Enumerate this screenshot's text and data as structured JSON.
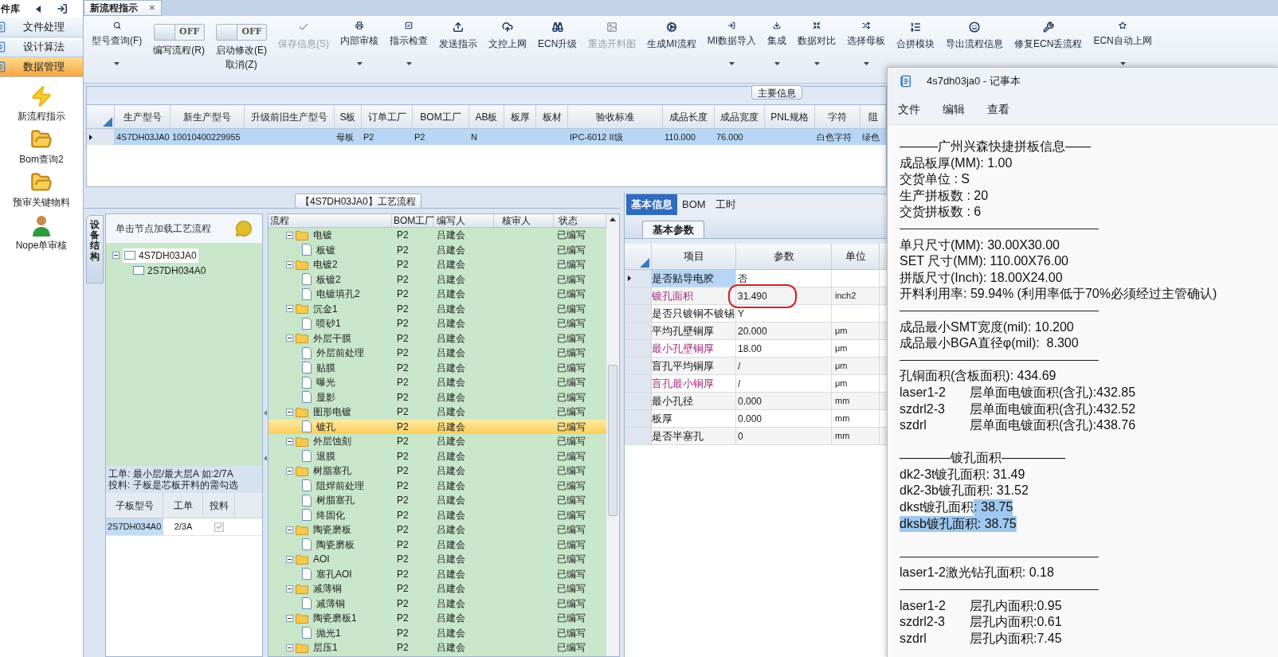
{
  "sidebar": {
    "title": "件库",
    "menu": [
      {
        "label": "文件处理",
        "selected": false
      },
      {
        "label": "设计算法",
        "selected": false
      },
      {
        "label": "数据管理",
        "selected": true
      }
    ],
    "launchers": [
      {
        "label": "新流程指示"
      },
      {
        "label": "Bom查询2"
      },
      {
        "label": "预审关键物料"
      },
      {
        "label": "Nope单审核"
      }
    ]
  },
  "document_tab": {
    "label": "新流程指示",
    "close": "×"
  },
  "toolbar": [
    {
      "kind": "button",
      "label": "型号查询(F)",
      "menu": true,
      "disabled": false
    },
    {
      "kind": "toggle",
      "label": "编写流程(R)",
      "on": false,
      "switch_text": "OFF"
    },
    {
      "kind": "toggle",
      "label": "启动修改(E)",
      "sublabel": "取消(Z)",
      "on": false,
      "switch_text": "OFF"
    },
    {
      "kind": "button",
      "label": "保存信息(S)",
      "menu": false,
      "disabled": true
    },
    {
      "kind": "button",
      "label": "内部审核",
      "menu": true,
      "disabled": false
    },
    {
      "kind": "button",
      "label": "指示检查",
      "menu": true,
      "disabled": false
    },
    {
      "kind": "button",
      "label": "发送指示",
      "menu": false,
      "disabled": false
    },
    {
      "kind": "button",
      "label": "文控上网",
      "menu": false,
      "disabled": false
    },
    {
      "kind": "button",
      "label": "ECN升级",
      "menu": false,
      "disabled": false
    },
    {
      "kind": "button",
      "label": "重选开料图",
      "menu": false,
      "disabled": true
    },
    {
      "kind": "button",
      "label": "生成MI流程",
      "menu": false,
      "disabled": false
    },
    {
      "kind": "button",
      "label": "MI数据导入",
      "menu": true,
      "disabled": false
    },
    {
      "kind": "button",
      "label": "集成",
      "menu": true,
      "disabled": false
    },
    {
      "kind": "button",
      "label": "数据对比",
      "menu": true,
      "disabled": false
    },
    {
      "kind": "button",
      "label": "选择母板",
      "menu": true,
      "disabled": false
    },
    {
      "kind": "button",
      "label": "合拼模块",
      "menu": false,
      "disabled": false
    },
    {
      "kind": "button",
      "label": "导出流程信息",
      "menu": false,
      "disabled": false
    },
    {
      "kind": "button",
      "label": "修复ECN丢流程",
      "menu": false,
      "disabled": false
    },
    {
      "kind": "button",
      "label": "ECN自动上网",
      "menu": true,
      "disabled": false
    }
  ],
  "main_info": {
    "title": "主要信息",
    "columns": [
      "生产型号",
      "新生产型号",
      "升级前旧生产型号",
      "S板",
      "订单工厂",
      "BOM工厂",
      "AB板",
      "板厚",
      "板材",
      "验收标准",
      "成品长度",
      "成品宽度",
      "PNL规格",
      "字符",
      "阻"
    ],
    "rows": [
      {
        "selected": true,
        "cells": [
          "4S7DH03JA0",
          "10010400229955",
          null,
          "母板",
          "P2",
          "P2",
          "N",
          null,
          null,
          "IPC-6012 II级",
          "110.000",
          "76.000",
          null,
          "白色字符",
          "绿色"
        ]
      }
    ]
  },
  "left_panel": {
    "vertical_tab": "设备结构",
    "hint": "单击节点加载工艺流程",
    "tree": [
      {
        "label": "4S7DH03JA0",
        "selected": true,
        "expanded": true,
        "children": [
          {
            "label": "2S7DH034A0",
            "selected": false
          }
        ]
      }
    ],
    "notes": [
      "工单: 最小层/最大层A 如:2/7A",
      "投料: 子板是芯板开料的需勾选"
    ],
    "sub_table": {
      "columns": [
        "子板型号",
        "工单",
        "投料"
      ],
      "rows": [
        {
          "board": "2S7DH034A0",
          "order": "2/3A",
          "feed": true
        }
      ]
    }
  },
  "process": {
    "title": "【4S7DH03JA0】工艺流程",
    "columns": [
      "流程",
      "BOM工厂",
      "编写人",
      "核审人",
      "状态"
    ],
    "rows": [
      {
        "name": "电镀",
        "bom": "P2",
        "writer": "吕建会",
        "status": "已编写",
        "selected": false,
        "expanded": true,
        "children": [
          {
            "name": "板镀",
            "bom": "P2",
            "writer": "吕建会",
            "status": "已编写",
            "selected": false
          }
        ]
      },
      {
        "name": "电镀2",
        "bom": "P2",
        "writer": "吕建会",
        "status": "已编写",
        "selected": false,
        "expanded": true,
        "children": [
          {
            "name": "板镀2",
            "bom": "P2",
            "writer": "吕建会",
            "status": "已编写",
            "selected": false
          },
          {
            "name": "电镀填孔2",
            "bom": "P2",
            "writer": "吕建会",
            "status": "已编写",
            "selected": false
          }
        ]
      },
      {
        "name": "沉金1",
        "bom": "P2",
        "writer": "吕建会",
        "status": "已编写",
        "selected": false,
        "expanded": true,
        "children": [
          {
            "name": "喷砂1",
            "bom": "P2",
            "writer": "吕建会",
            "status": "已编写",
            "selected": false
          }
        ]
      },
      {
        "name": "外层干膜",
        "bom": "P2",
        "writer": "吕建会",
        "status": "已编写",
        "selected": false,
        "expanded": true,
        "children": [
          {
            "name": "外层前处理",
            "bom": "P2",
            "writer": "吕建会",
            "status": "已编写",
            "selected": false
          },
          {
            "name": "贴膜",
            "bom": "P2",
            "writer": "吕建会",
            "status": "已编写",
            "selected": false
          },
          {
            "name": "曝光",
            "bom": "P2",
            "writer": "吕建会",
            "status": "已编写",
            "selected": false
          },
          {
            "name": "显影",
            "bom": "P2",
            "writer": "吕建会",
            "status": "已编写",
            "selected": false
          }
        ]
      },
      {
        "name": "图形电镀",
        "bom": "P2",
        "writer": "吕建会",
        "status": "已编写",
        "selected": false,
        "expanded": true,
        "children": [
          {
            "name": "镀孔",
            "bom": "P2",
            "writer": "吕建会",
            "status": "已编写",
            "selected": true
          }
        ]
      },
      {
        "name": "外层蚀刻",
        "bom": "P2",
        "writer": "吕建会",
        "status": "已编写",
        "selected": false,
        "expanded": true,
        "children": [
          {
            "name": "退膜",
            "bom": "P2",
            "writer": "吕建会",
            "status": "已编写",
            "selected": false
          }
        ]
      },
      {
        "name": "树脂塞孔",
        "bom": "P2",
        "writer": "吕建会",
        "status": "已编写",
        "selected": false,
        "expanded": true,
        "children": [
          {
            "name": "阻焊前处理",
            "bom": "P2",
            "writer": "吕建会",
            "status": "已编写",
            "selected": false
          },
          {
            "name": "树脂塞孔",
            "bom": "P2",
            "writer": "吕建会",
            "status": "已编写",
            "selected": false
          },
          {
            "name": "终固化",
            "bom": "P2",
            "writer": "吕建会",
            "status": "已编写",
            "selected": false
          }
        ]
      },
      {
        "name": "陶瓷磨板",
        "bom": "P2",
        "writer": "吕建会",
        "status": "已编写",
        "selected": false,
        "expanded": true,
        "children": [
          {
            "name": "陶瓷磨板",
            "bom": "P2",
            "writer": "吕建会",
            "status": "已编写",
            "selected": false
          }
        ]
      },
      {
        "name": "AOI",
        "bom": "P2",
        "writer": "吕建会",
        "status": "已编写",
        "selected": false,
        "expanded": true,
        "children": [
          {
            "name": "塞孔AOI",
            "bom": "P2",
            "writer": "吕建会",
            "status": "已编写",
            "selected": false
          }
        ]
      },
      {
        "name": "减薄铜",
        "bom": "P2",
        "writer": "吕建会",
        "status": "已编写",
        "selected": false,
        "expanded": true,
        "children": [
          {
            "name": "减薄铜",
            "bom": "P2",
            "writer": "吕建会",
            "status": "已编写",
            "selected": false
          }
        ]
      },
      {
        "name": "陶瓷磨板1",
        "bom": "P2",
        "writer": "吕建会",
        "status": "已编写",
        "selected": false,
        "expanded": true,
        "children": [
          {
            "name": "抛光1",
            "bom": "P2",
            "writer": "吕建会",
            "status": "已编写",
            "selected": false
          }
        ]
      },
      {
        "name": "层压1",
        "bom": "P2",
        "writer": "吕建会",
        "status": "已编写",
        "selected": false,
        "expanded": true
      }
    ]
  },
  "details": {
    "tabs": [
      {
        "label": "基本信息",
        "selected": true
      },
      {
        "label": "BOM",
        "selected": false
      },
      {
        "label": "工时",
        "selected": false
      }
    ],
    "subtabs": [
      {
        "label": "基本参数",
        "selected": true
      }
    ],
    "columns": [
      "项目",
      "参数",
      "单位"
    ],
    "rows": [
      {
        "item": "是否贴导电胶",
        "value": "否",
        "selected": true,
        "emphasis": false,
        "circled": false
      },
      {
        "item": "镀孔面积",
        "value": "31.490",
        "unit": "inch2",
        "selected": false,
        "emphasis": true,
        "circled": true
      },
      {
        "item": "是否只镀铜不镀锡",
        "value": "Y",
        "selected": false,
        "emphasis": false,
        "circled": false
      },
      {
        "item": "平均孔壁铜厚",
        "value": "20.000",
        "unit": "μm",
        "selected": false,
        "emphasis": false,
        "circled": false
      },
      {
        "item": "最小孔壁铜厚",
        "value": "18.00",
        "unit": "μm",
        "selected": false,
        "emphasis": true,
        "circled": false
      },
      {
        "item": "盲孔平均铜厚",
        "value": "/",
        "unit": "μm",
        "selected": false,
        "emphasis": false,
        "circled": false
      },
      {
        "item": "盲孔最小铜厚",
        "value": "/",
        "unit": "μm",
        "selected": false,
        "emphasis": true,
        "circled": false
      },
      {
        "item": "最小孔径",
        "value": "0.000",
        "unit": "mm",
        "selected": false,
        "emphasis": false,
        "circled": false
      },
      {
        "item": "板厚",
        "value": "0.000",
        "unit": "mm",
        "selected": false,
        "emphasis": false,
        "circled": false
      },
      {
        "item": "是否半塞孔",
        "value": "0",
        "unit": "mm",
        "selected": false,
        "emphasis": false,
        "circled": false
      }
    ]
  },
  "notepad": {
    "title": "4s7dh03ja0 - 记事本",
    "menu": [
      "文件",
      "编辑",
      "查看"
    ],
    "lines": [
      {
        "kind": "text",
        "text": "———广州兴森快捷拼板信息——"
      },
      {
        "kind": "text",
        "text": "成品板厚(MM): 1.00"
      },
      {
        "kind": "text",
        "text": "交货单位 : S"
      },
      {
        "kind": "text",
        "text": "生产拼板数 : 20"
      },
      {
        "kind": "text",
        "text": "交货拼板数 : 6"
      },
      {
        "kind": "rule"
      },
      {
        "kind": "text",
        "text": "单只尺寸(MM): 30.00X30.00"
      },
      {
        "kind": "text",
        "text": "SET 尺寸(MM): 110.00X76.00"
      },
      {
        "kind": "text",
        "text": "拼版尺寸(Inch): 18.00X24.00"
      },
      {
        "kind": "text",
        "text": "开料利用率: 59.94% (利用率低于70%必须经过主管确认)"
      },
      {
        "kind": "rule"
      },
      {
        "kind": "text",
        "text": "成品最小SMT宽度(mil): 10.200"
      },
      {
        "kind": "text",
        "text": "成品最小BGA直径φ(mil):  8.300"
      },
      {
        "kind": "rule"
      },
      {
        "kind": "text",
        "text": "孔铜面积(含板面积): 434.69"
      },
      {
        "kind": "pair",
        "label": "laser1-2",
        "value": "层单面电镀面积(含孔):432.85"
      },
      {
        "kind": "pair",
        "label": "szdrl2-3",
        "value": "层单面电镀面积(含孔):432.52"
      },
      {
        "kind": "pair",
        "label": "szdrl",
        "value": "层单面电镀面积(含孔):438.76"
      },
      {
        "kind": "blank"
      },
      {
        "kind": "text",
        "text": "————镀孔面积—————"
      },
      {
        "kind": "text",
        "text": "dk2-3t镀孔面积: 31.49"
      },
      {
        "kind": "text",
        "text": "dk2-3b镀孔面积: 31.52"
      },
      {
        "kind": "parts",
        "parts": [
          {
            "text": "dkst镀孔面积",
            "selected": false
          },
          {
            "text": ": 38.75",
            "selected": true
          }
        ]
      },
      {
        "kind": "parts",
        "parts": [
          {
            "text": "dksb镀孔面积: 38.75",
            "selected": true
          }
        ]
      },
      {
        "kind": "blank"
      },
      {
        "kind": "rule"
      },
      {
        "kind": "text",
        "text": "laser1-2激光钻孔面积: 0.18"
      },
      {
        "kind": "rule"
      },
      {
        "kind": "pair",
        "label": "laser1-2",
        "value": "层孔内面积:0.95"
      },
      {
        "kind": "pair",
        "label": "szdrl2-3",
        "value": "层孔内面积:0.61"
      },
      {
        "kind": "pair",
        "label": "szdrl",
        "value": "层孔内面积:7.45"
      }
    ]
  }
}
